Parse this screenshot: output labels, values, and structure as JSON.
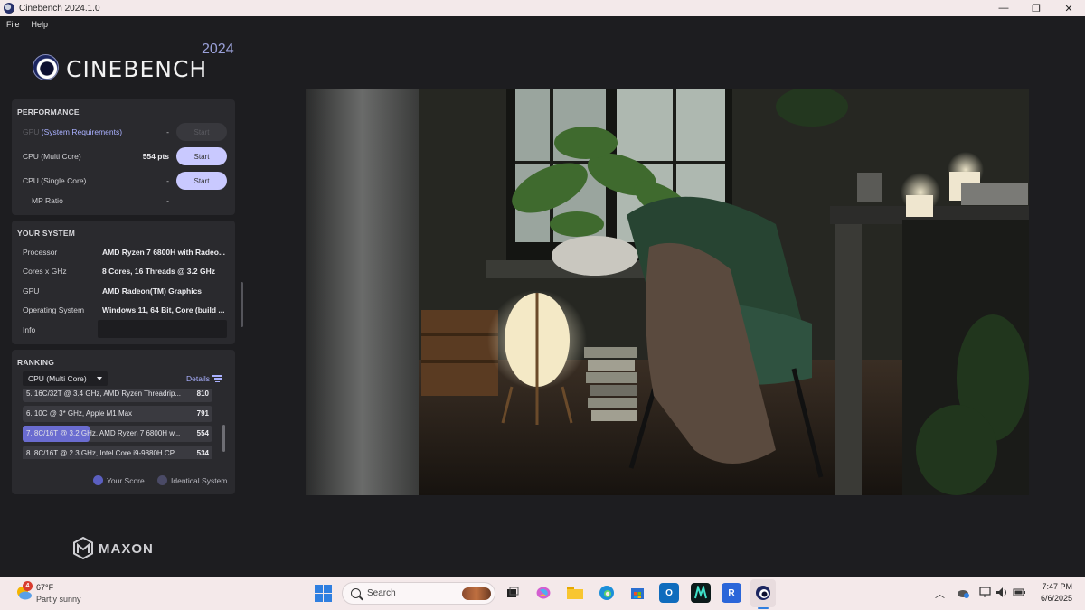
{
  "window": {
    "title": "Cinebench 2024.1.0",
    "minimize": "—",
    "restore": "❐",
    "close": "✕"
  },
  "menu": [
    "File",
    "Help"
  ],
  "logo": {
    "word": "CINEBENCH",
    "year": "2024"
  },
  "performance": {
    "title": "PERFORMANCE",
    "rows": [
      {
        "label_dim": "GPU",
        "label_link": "(System Requirements)",
        "value": "-",
        "button": "Start",
        "enabled": false
      },
      {
        "label": "CPU (Multi Core)",
        "value": "554 pts",
        "button": "Start",
        "enabled": true
      },
      {
        "label": "CPU (Single Core)",
        "value": "-",
        "button": "Start",
        "enabled": true
      },
      {
        "label": "MP Ratio",
        "value": "-"
      }
    ]
  },
  "system": {
    "title": "YOUR SYSTEM",
    "rows": [
      {
        "label": "Processor",
        "value": "AMD Ryzen 7 6800H with Radeo..."
      },
      {
        "label": "Cores x GHz",
        "value": "8 Cores, 16 Threads @ 3.2 GHz"
      },
      {
        "label": "GPU",
        "value": "AMD Radeon(TM) Graphics"
      },
      {
        "label": "Operating System",
        "value": "Windows 11, 64 Bit, Core (build ..."
      },
      {
        "label": "Info",
        "value": ""
      }
    ]
  },
  "ranking": {
    "title": "RANKING",
    "selected": "CPU (Multi Core)",
    "details": "Details",
    "items": [
      {
        "name": "5. 16C/32T @ 3.4 GHz, AMD Ryzen Threadrip...",
        "score": "810",
        "mine": false,
        "fill": 0
      },
      {
        "name": "6. 10C @ 3* GHz, Apple M1 Max",
        "score": "791",
        "mine": false,
        "fill": 0
      },
      {
        "name": "7. 8C/16T @ 3.2 GHz, AMD Ryzen 7 6800H w...",
        "score": "554",
        "mine": true,
        "fill": 0.35
      },
      {
        "name": "8. 8C/16T @ 2.3 GHz, Intel Core i9-9880H CP...",
        "score": "534",
        "mine": false,
        "fill": 0
      }
    ],
    "legend": [
      {
        "label": "Your Score",
        "color": "#5b5fc0"
      },
      {
        "label": "Identical System",
        "color": "#4a4a66"
      }
    ]
  },
  "brand": "MAXON",
  "taskbar": {
    "weather": {
      "badge": "4",
      "temp": "67°F",
      "desc": "Partly sunny"
    },
    "search_placeholder": "Search",
    "time": "7:47 PM",
    "date": "6/6/2025"
  }
}
